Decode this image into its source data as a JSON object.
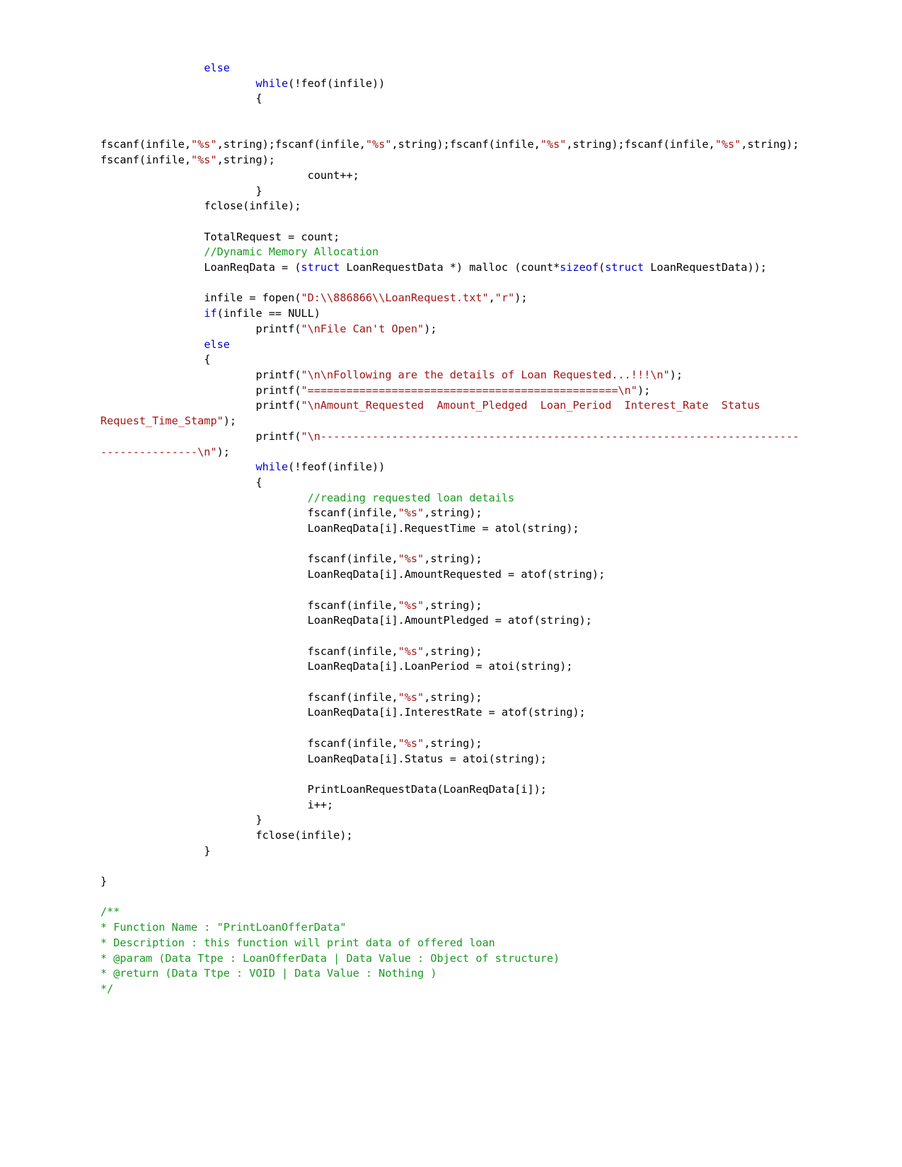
{
  "document": {
    "kind": "source-code-listing",
    "language": "C",
    "page_background": "#ffffff",
    "colors": {
      "default_text": "#000000",
      "keyword": "#0000cc",
      "string": "#a31515",
      "comment": "#1a9a21"
    }
  },
  "code": {
    "lines": [
      {
        "id": "l1",
        "indent": 2,
        "tokens": [
          {
            "t": "kw",
            "v": "else"
          }
        ]
      },
      {
        "id": "l2",
        "indent": 3,
        "tokens": [
          {
            "t": "kw",
            "v": "while"
          },
          {
            "t": "pln",
            "v": "(!feof(infile))"
          }
        ]
      },
      {
        "id": "l3",
        "indent": 3,
        "tokens": [
          {
            "t": "pln",
            "v": "{"
          }
        ]
      },
      {
        "id": "l4",
        "indent": 0,
        "tokens": []
      },
      {
        "id": "l5",
        "indent": 0,
        "tokens": []
      },
      {
        "id": "l6",
        "indent": 0,
        "tokens": [
          {
            "t": "pln",
            "v": "fscanf(infile,"
          },
          {
            "t": "str",
            "v": "\"%s\""
          },
          {
            "t": "pln",
            "v": ",string);fscanf(infile,"
          },
          {
            "t": "str",
            "v": "\"%s\""
          },
          {
            "t": "pln",
            "v": ",string);fscanf(infile,"
          },
          {
            "t": "str",
            "v": "\"%s\""
          },
          {
            "t": "pln",
            "v": ",string);fscanf(infile,"
          },
          {
            "t": "str",
            "v": "\"%s\""
          },
          {
            "t": "pln",
            "v": ",string);fscanf(infile,"
          },
          {
            "t": "str",
            "v": "\"%s\""
          },
          {
            "t": "pln",
            "v": ",string);"
          }
        ]
      },
      {
        "id": "l7",
        "indent": 4,
        "tokens": [
          {
            "t": "pln",
            "v": "count++;"
          }
        ]
      },
      {
        "id": "l8",
        "indent": 3,
        "tokens": [
          {
            "t": "pln",
            "v": "}"
          }
        ]
      },
      {
        "id": "l9",
        "indent": 2,
        "tokens": [
          {
            "t": "pln",
            "v": "fclose(infile);"
          }
        ]
      },
      {
        "id": "l10",
        "indent": 0,
        "tokens": []
      },
      {
        "id": "l11",
        "indent": 2,
        "tokens": [
          {
            "t": "pln",
            "v": "TotalRequest = count;"
          }
        ]
      },
      {
        "id": "l12",
        "indent": 2,
        "tokens": [
          {
            "t": "cmt",
            "v": "//Dynamic Memory Allocation"
          }
        ]
      },
      {
        "id": "l13",
        "indent": 2,
        "tokens": [
          {
            "t": "pln",
            "v": "LoanReqData = ("
          },
          {
            "t": "kw",
            "v": "struct"
          },
          {
            "t": "pln",
            "v": " LoanRequestData *) malloc (count*"
          },
          {
            "t": "kw",
            "v": "sizeof"
          },
          {
            "t": "pln",
            "v": "("
          },
          {
            "t": "kw",
            "v": "struct"
          },
          {
            "t": "pln",
            "v": " LoanRequestData));"
          }
        ]
      },
      {
        "id": "l14",
        "indent": 0,
        "tokens": []
      },
      {
        "id": "l15",
        "indent": 2,
        "tokens": [
          {
            "t": "pln",
            "v": "infile = fopen("
          },
          {
            "t": "str",
            "v": "\"D:\\\\886866\\\\LoanRequest.txt\""
          },
          {
            "t": "pln",
            "v": ","
          },
          {
            "t": "str",
            "v": "\"r\""
          },
          {
            "t": "pln",
            "v": ");"
          }
        ]
      },
      {
        "id": "l16",
        "indent": 2,
        "tokens": [
          {
            "t": "kw",
            "v": "if"
          },
          {
            "t": "pln",
            "v": "(infile == NULL)"
          }
        ]
      },
      {
        "id": "l17",
        "indent": 3,
        "tokens": [
          {
            "t": "pln",
            "v": "printf("
          },
          {
            "t": "str",
            "v": "\"\\nFile Can't Open\""
          },
          {
            "t": "pln",
            "v": ");"
          }
        ]
      },
      {
        "id": "l18",
        "indent": 2,
        "tokens": [
          {
            "t": "kw",
            "v": "else"
          }
        ]
      },
      {
        "id": "l19",
        "indent": 2,
        "tokens": [
          {
            "t": "pln",
            "v": "{"
          }
        ]
      },
      {
        "id": "l20",
        "indent": 3,
        "tokens": [
          {
            "t": "pln",
            "v": "printf("
          },
          {
            "t": "str",
            "v": "\"\\n\\nFollowing are the details of Loan Requested...!!!\\n\""
          },
          {
            "t": "pln",
            "v": ");"
          }
        ]
      },
      {
        "id": "l21",
        "indent": 3,
        "tokens": [
          {
            "t": "pln",
            "v": "printf("
          },
          {
            "t": "str",
            "v": "\"================================================\\n\""
          },
          {
            "t": "pln",
            "v": ");"
          }
        ]
      },
      {
        "id": "l22",
        "indent": 3,
        "tokens": [
          {
            "t": "pln",
            "v": "printf("
          },
          {
            "t": "str",
            "v": "\"\\nAmount_Requested  Amount_Pledged  Loan_Period  Interest_Rate  Status  Request_Time_Stamp\""
          },
          {
            "t": "pln",
            "v": ");"
          }
        ]
      },
      {
        "id": "l23",
        "indent": 3,
        "tokens": [
          {
            "t": "pln",
            "v": "printf("
          },
          {
            "t": "str",
            "v": "\"\\n-----------------------------------------------------------------------------------------\\n\""
          },
          {
            "t": "pln",
            "v": ");"
          }
        ]
      },
      {
        "id": "l24",
        "indent": 3,
        "tokens": [
          {
            "t": "kw",
            "v": "while"
          },
          {
            "t": "pln",
            "v": "(!feof(infile))"
          }
        ]
      },
      {
        "id": "l25",
        "indent": 3,
        "tokens": [
          {
            "t": "pln",
            "v": "{"
          }
        ]
      },
      {
        "id": "l26",
        "indent": 4,
        "tokens": [
          {
            "t": "cmt",
            "v": "//reading requested loan details"
          }
        ]
      },
      {
        "id": "l27",
        "indent": 4,
        "tokens": [
          {
            "t": "pln",
            "v": "fscanf(infile,"
          },
          {
            "t": "str",
            "v": "\"%s\""
          },
          {
            "t": "pln",
            "v": ",string);"
          }
        ]
      },
      {
        "id": "l28",
        "indent": 4,
        "tokens": [
          {
            "t": "pln",
            "v": "LoanReqData[i].RequestTime = atol(string);"
          }
        ]
      },
      {
        "id": "l29",
        "indent": 0,
        "tokens": []
      },
      {
        "id": "l30",
        "indent": 4,
        "tokens": [
          {
            "t": "pln",
            "v": "fscanf(infile,"
          },
          {
            "t": "str",
            "v": "\"%s\""
          },
          {
            "t": "pln",
            "v": ",string);"
          }
        ]
      },
      {
        "id": "l31",
        "indent": 4,
        "tokens": [
          {
            "t": "pln",
            "v": "LoanReqData[i].AmountRequested = atof(string);"
          }
        ]
      },
      {
        "id": "l32",
        "indent": 0,
        "tokens": []
      },
      {
        "id": "l33",
        "indent": 4,
        "tokens": [
          {
            "t": "pln",
            "v": "fscanf(infile,"
          },
          {
            "t": "str",
            "v": "\"%s\""
          },
          {
            "t": "pln",
            "v": ",string);"
          }
        ]
      },
      {
        "id": "l34",
        "indent": 4,
        "tokens": [
          {
            "t": "pln",
            "v": "LoanReqData[i].AmountPledged = atof(string);"
          }
        ]
      },
      {
        "id": "l35",
        "indent": 0,
        "tokens": []
      },
      {
        "id": "l36",
        "indent": 4,
        "tokens": [
          {
            "t": "pln",
            "v": "fscanf(infile,"
          },
          {
            "t": "str",
            "v": "\"%s\""
          },
          {
            "t": "pln",
            "v": ",string);"
          }
        ]
      },
      {
        "id": "l37",
        "indent": 4,
        "tokens": [
          {
            "t": "pln",
            "v": "LoanReqData[i].LoanPeriod = atoi(string);"
          }
        ]
      },
      {
        "id": "l38",
        "indent": 0,
        "tokens": []
      },
      {
        "id": "l39",
        "indent": 4,
        "tokens": [
          {
            "t": "pln",
            "v": "fscanf(infile,"
          },
          {
            "t": "str",
            "v": "\"%s\""
          },
          {
            "t": "pln",
            "v": ",string);"
          }
        ]
      },
      {
        "id": "l40",
        "indent": 4,
        "tokens": [
          {
            "t": "pln",
            "v": "LoanReqData[i].InterestRate = atof(string);"
          }
        ]
      },
      {
        "id": "l41",
        "indent": 0,
        "tokens": []
      },
      {
        "id": "l42",
        "indent": 4,
        "tokens": [
          {
            "t": "pln",
            "v": "fscanf(infile,"
          },
          {
            "t": "str",
            "v": "\"%s\""
          },
          {
            "t": "pln",
            "v": ",string);"
          }
        ]
      },
      {
        "id": "l43",
        "indent": 4,
        "tokens": [
          {
            "t": "pln",
            "v": "LoanReqData[i].Status = atoi(string);"
          }
        ]
      },
      {
        "id": "l44",
        "indent": 0,
        "tokens": []
      },
      {
        "id": "l45",
        "indent": 4,
        "tokens": [
          {
            "t": "pln",
            "v": "PrintLoanRequestData(LoanReqData[i]);"
          }
        ]
      },
      {
        "id": "l46",
        "indent": 4,
        "tokens": [
          {
            "t": "pln",
            "v": "i++;"
          }
        ]
      },
      {
        "id": "l47",
        "indent": 3,
        "tokens": [
          {
            "t": "pln",
            "v": "}"
          }
        ]
      },
      {
        "id": "l48",
        "indent": 3,
        "tokens": [
          {
            "t": "pln",
            "v": "fclose(infile);"
          }
        ]
      },
      {
        "id": "l49",
        "indent": 2,
        "tokens": [
          {
            "t": "pln",
            "v": "}"
          }
        ]
      },
      {
        "id": "l50",
        "indent": 0,
        "tokens": []
      },
      {
        "id": "l51",
        "indent": 0,
        "tokens": [
          {
            "t": "pln",
            "v": "}"
          }
        ]
      },
      {
        "id": "l52",
        "indent": 0,
        "tokens": []
      },
      {
        "id": "l53",
        "indent": 0,
        "tokens": [
          {
            "t": "cmt",
            "v": "/**"
          }
        ]
      },
      {
        "id": "l54",
        "indent": 0,
        "tokens": [
          {
            "t": "cmt",
            "v": "* Function Name : \"PrintLoanOfferData\""
          }
        ]
      },
      {
        "id": "l55",
        "indent": 0,
        "tokens": [
          {
            "t": "cmt",
            "v": "* Description : this function will print data of offered loan"
          }
        ]
      },
      {
        "id": "l56",
        "indent": 0,
        "tokens": [
          {
            "t": "cmt",
            "v": "* @param (Data Ttpe : LoanOfferData | Data Value : Object of structure)"
          }
        ]
      },
      {
        "id": "l57",
        "indent": 0,
        "tokens": [
          {
            "t": "cmt",
            "v": "* @return (Data Ttpe : VOID | Data Value : Nothing )"
          }
        ]
      },
      {
        "id": "l58",
        "indent": 0,
        "tokens": [
          {
            "t": "cmt",
            "v": "*/"
          }
        ]
      }
    ]
  }
}
